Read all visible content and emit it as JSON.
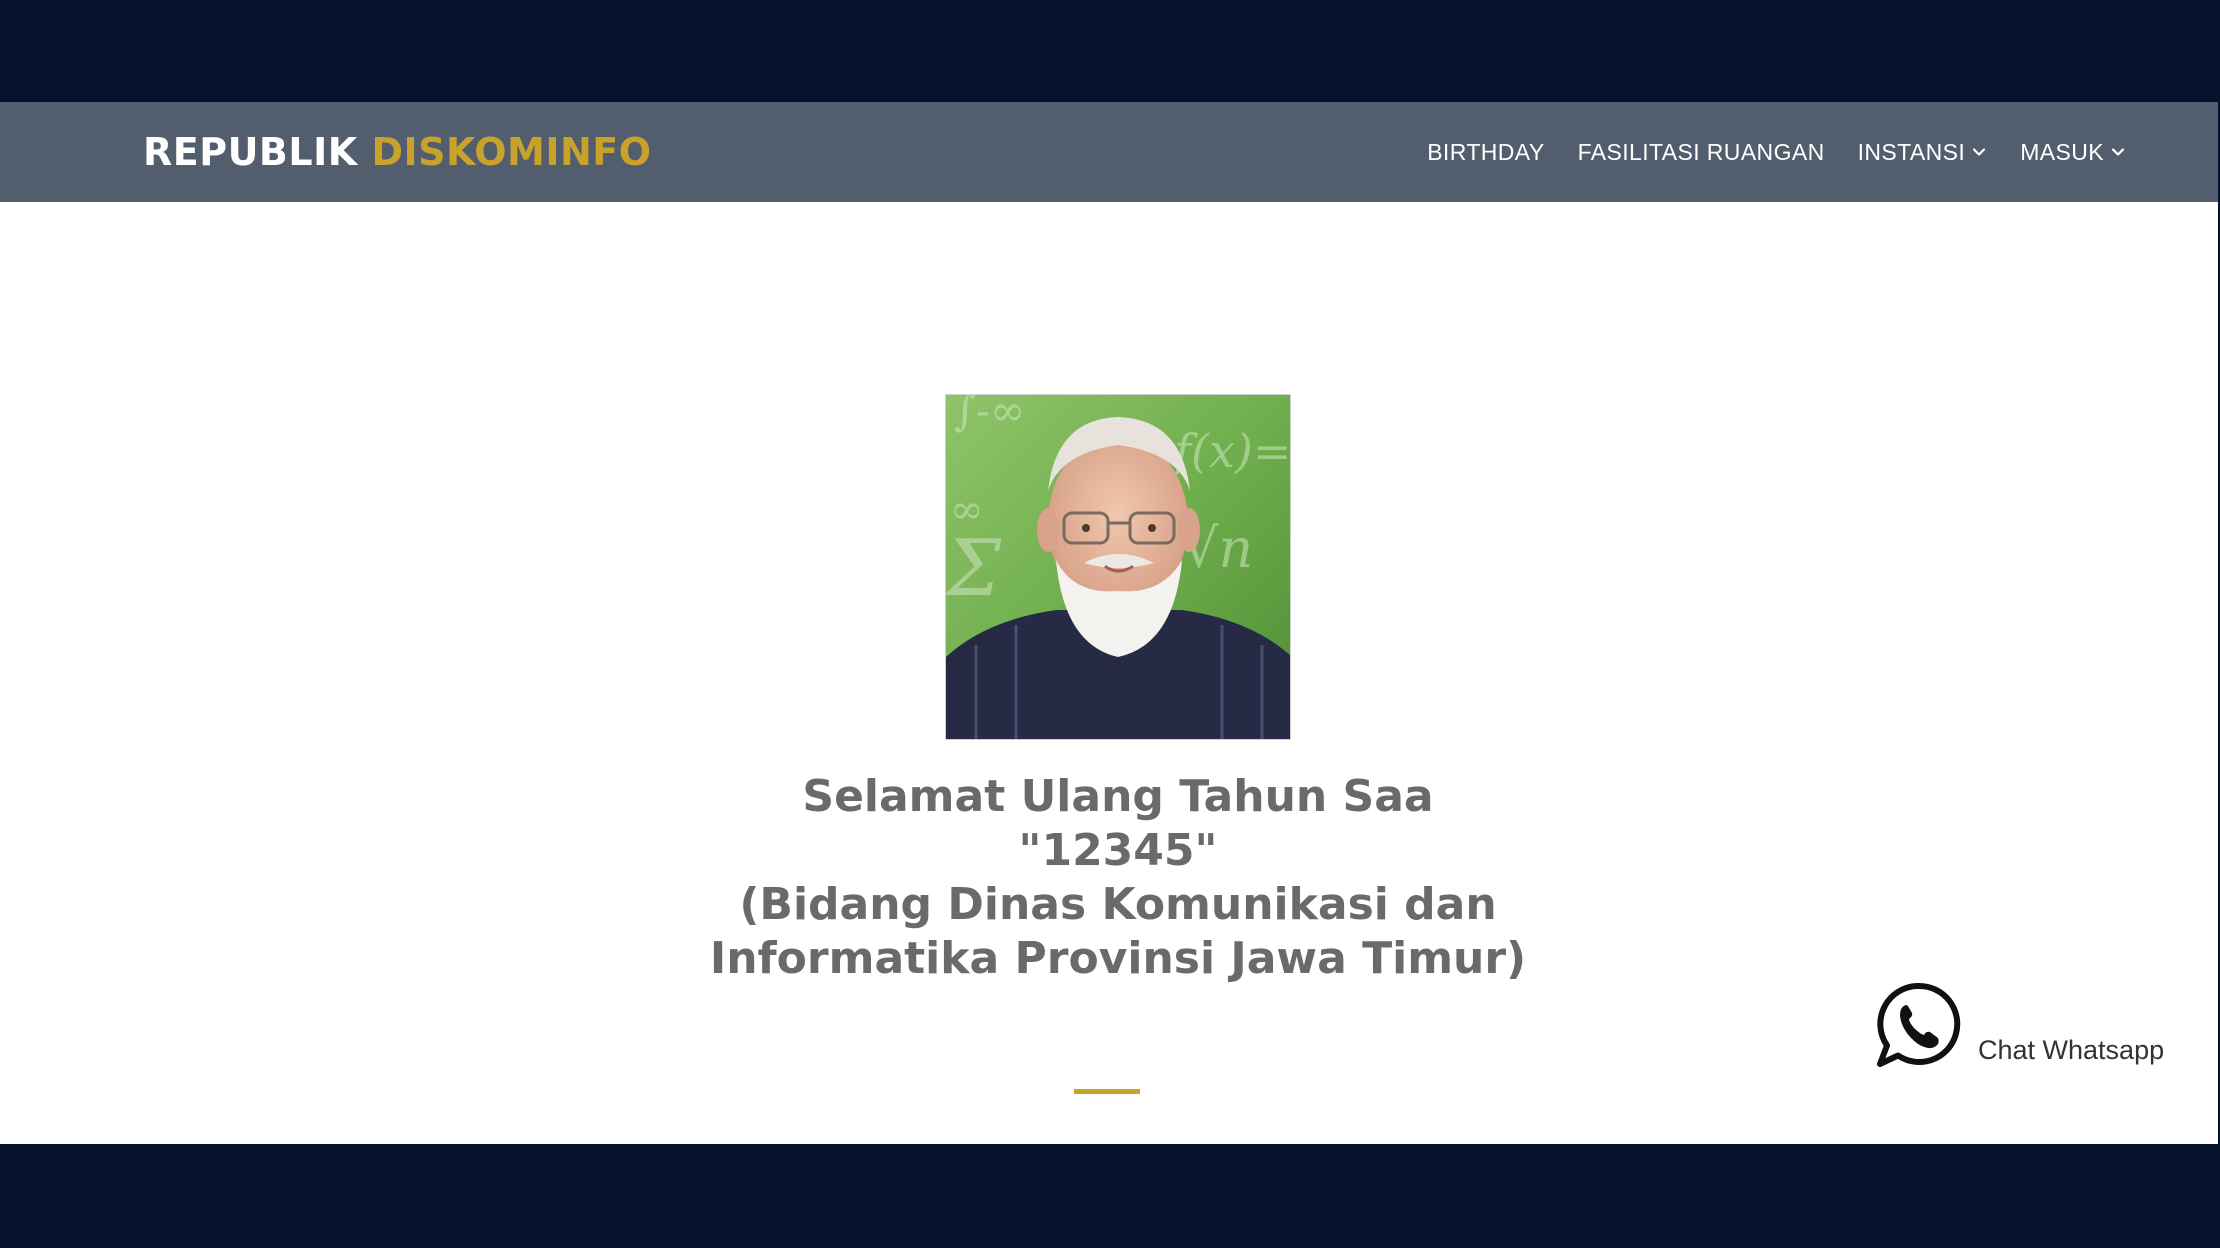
{
  "header": {
    "brand_part1": "REPUBLIK",
    "brand_part2": "DISKOMINFO",
    "nav": [
      {
        "label": "BIRTHDAY",
        "icon": null
      },
      {
        "label": "FASILITASI RUANGAN",
        "icon": null
      },
      {
        "label": "INSTANSI",
        "icon": "chevron-down-icon"
      },
      {
        "label": "MASUK",
        "icon": "chevron-down-icon"
      }
    ]
  },
  "main": {
    "photo_icon": "person-portrait",
    "greeting_lines": [
      "Selamat Ulang Tahun Saa",
      "\"12345\"",
      "(Bidang Dinas Komunikasi dan",
      "Informatika Provinsi Jawa Timur)"
    ]
  },
  "whatsapp": {
    "label": "Chat Whatsapp",
    "icon": "whatsapp-icon"
  },
  "colors": {
    "dark_band": "#05132d",
    "navbar": "#525d6d",
    "accent_gold": "#c9a22b",
    "greeting_text": "#6a6a6a"
  }
}
